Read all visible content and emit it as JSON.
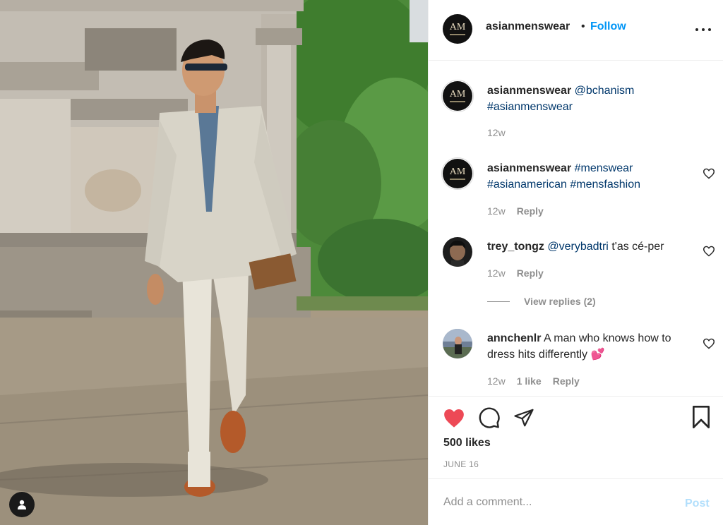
{
  "post": {
    "username": "asianmenswear",
    "dot": "•",
    "follow_label": "Follow",
    "avatar_monogram": "AM"
  },
  "comments": [
    {
      "username": "asianmenswear",
      "text_parts": [
        "@bchanism",
        "#asianmenswear"
      ],
      "time": "12w"
    },
    {
      "username": "asianmenswear",
      "text_parts": [
        "#menswear",
        "#asianamerican",
        "#mensfashion"
      ],
      "time": "12w",
      "reply_label": "Reply"
    },
    {
      "username": "trey_tongz",
      "mention": "@verybadtri",
      "text": "t'as cé-per",
      "time": "12w",
      "reply_label": "Reply"
    },
    {
      "username": "annchenlr",
      "text": "A man who knows how to dress hits differently",
      "emoji": "💕",
      "time": "12w",
      "likes_label": "1 like",
      "reply_label": "Reply"
    }
  ],
  "view_replies_label": "View replies (2)",
  "likes_count": "500 likes",
  "post_date": "JUNE 16",
  "add_comment": {
    "placeholder": "Add a comment...",
    "post_label": "Post"
  },
  "colors": {
    "link": "#00376b",
    "follow": "#0095f6",
    "like_red": "#ed4956",
    "post_disabled": "#b2dffc",
    "muted": "#8e8e8e"
  },
  "icons": [
    "more-options-icon",
    "heart-outline-icon",
    "heart-filled-icon",
    "comment-icon",
    "share-icon",
    "bookmark-icon",
    "user-tag-icon"
  ]
}
